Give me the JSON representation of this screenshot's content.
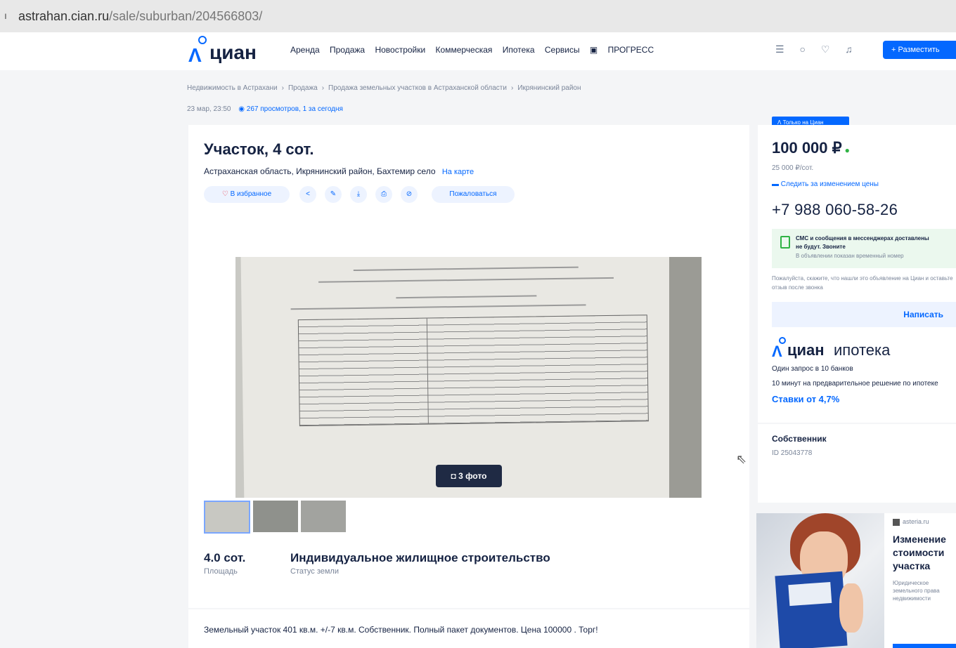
{
  "browser": {
    "url_host": "astrahan.cian.ru",
    "url_path": "/sale/suburban/204566803/"
  },
  "header": {
    "logo_text": "циан",
    "nav": [
      "Аренда",
      "Продажа",
      "Новостройки",
      "Коммерческая",
      "Ипотека",
      "Сервисы",
      "ПРОГРЕСС"
    ],
    "post_button": "+ Разместить"
  },
  "breadcrumbs": [
    "Недвижимость в Астрахани",
    "Продажа",
    "Продажа земельных участков в Астраханской области",
    "Икрянинский район"
  ],
  "meta": {
    "date": "23 мар, 23:50",
    "views": "267 просмотров, 1 за сегодня"
  },
  "listing": {
    "title": "Участок, 4 сот.",
    "address": "Астраханская область, Икрянинский район, Бахтемир село",
    "map_link": "На карте",
    "favorite_label": "В избранное",
    "complain_label": "Пожаловаться",
    "photo_count": "3 фото",
    "area_value": "4.0 сот.",
    "area_label": "Площадь",
    "land_status_value": "Индивидуальное жилищное строительство",
    "land_status_label": "Статус земли",
    "description": "Земельный участок 401 кв.м. +/-7 кв.м. Собственник. Полный пакет документов. Цена 100000 . Торг!"
  },
  "sidebar": {
    "only_badge": "Только на Циан",
    "price": "100 000 ₽",
    "price_per": "25 000 ₽/сот.",
    "track_price": "Следить за изменением цены",
    "phone": "+7 988 060-58-26",
    "sms_notice": "СМС и сообщения в мессенджерах доставлены не будут. Звоните",
    "sms_subnotice": "В объявлении показан временный номер",
    "please_text": "Пожалуйста, скажите, что нашли это объявление на Циан и оставьте отзыв после звонка",
    "write_button": "Написать",
    "ipoteka": {
      "brand": "циан",
      "product": "ипотека",
      "line1": "Один запрос в 10 банков",
      "line2": "10 минут на предварительное решение по ипотеке",
      "rates": "Ставки от 4,7%"
    },
    "owner_title": "Собственник",
    "owner_id": "ID 25043778"
  },
  "ad": {
    "source": "asteria.ru",
    "headline": "Изменение\nстоимости\nучастка",
    "text": "Юридическое\nземельного права\nнедвижимости"
  }
}
